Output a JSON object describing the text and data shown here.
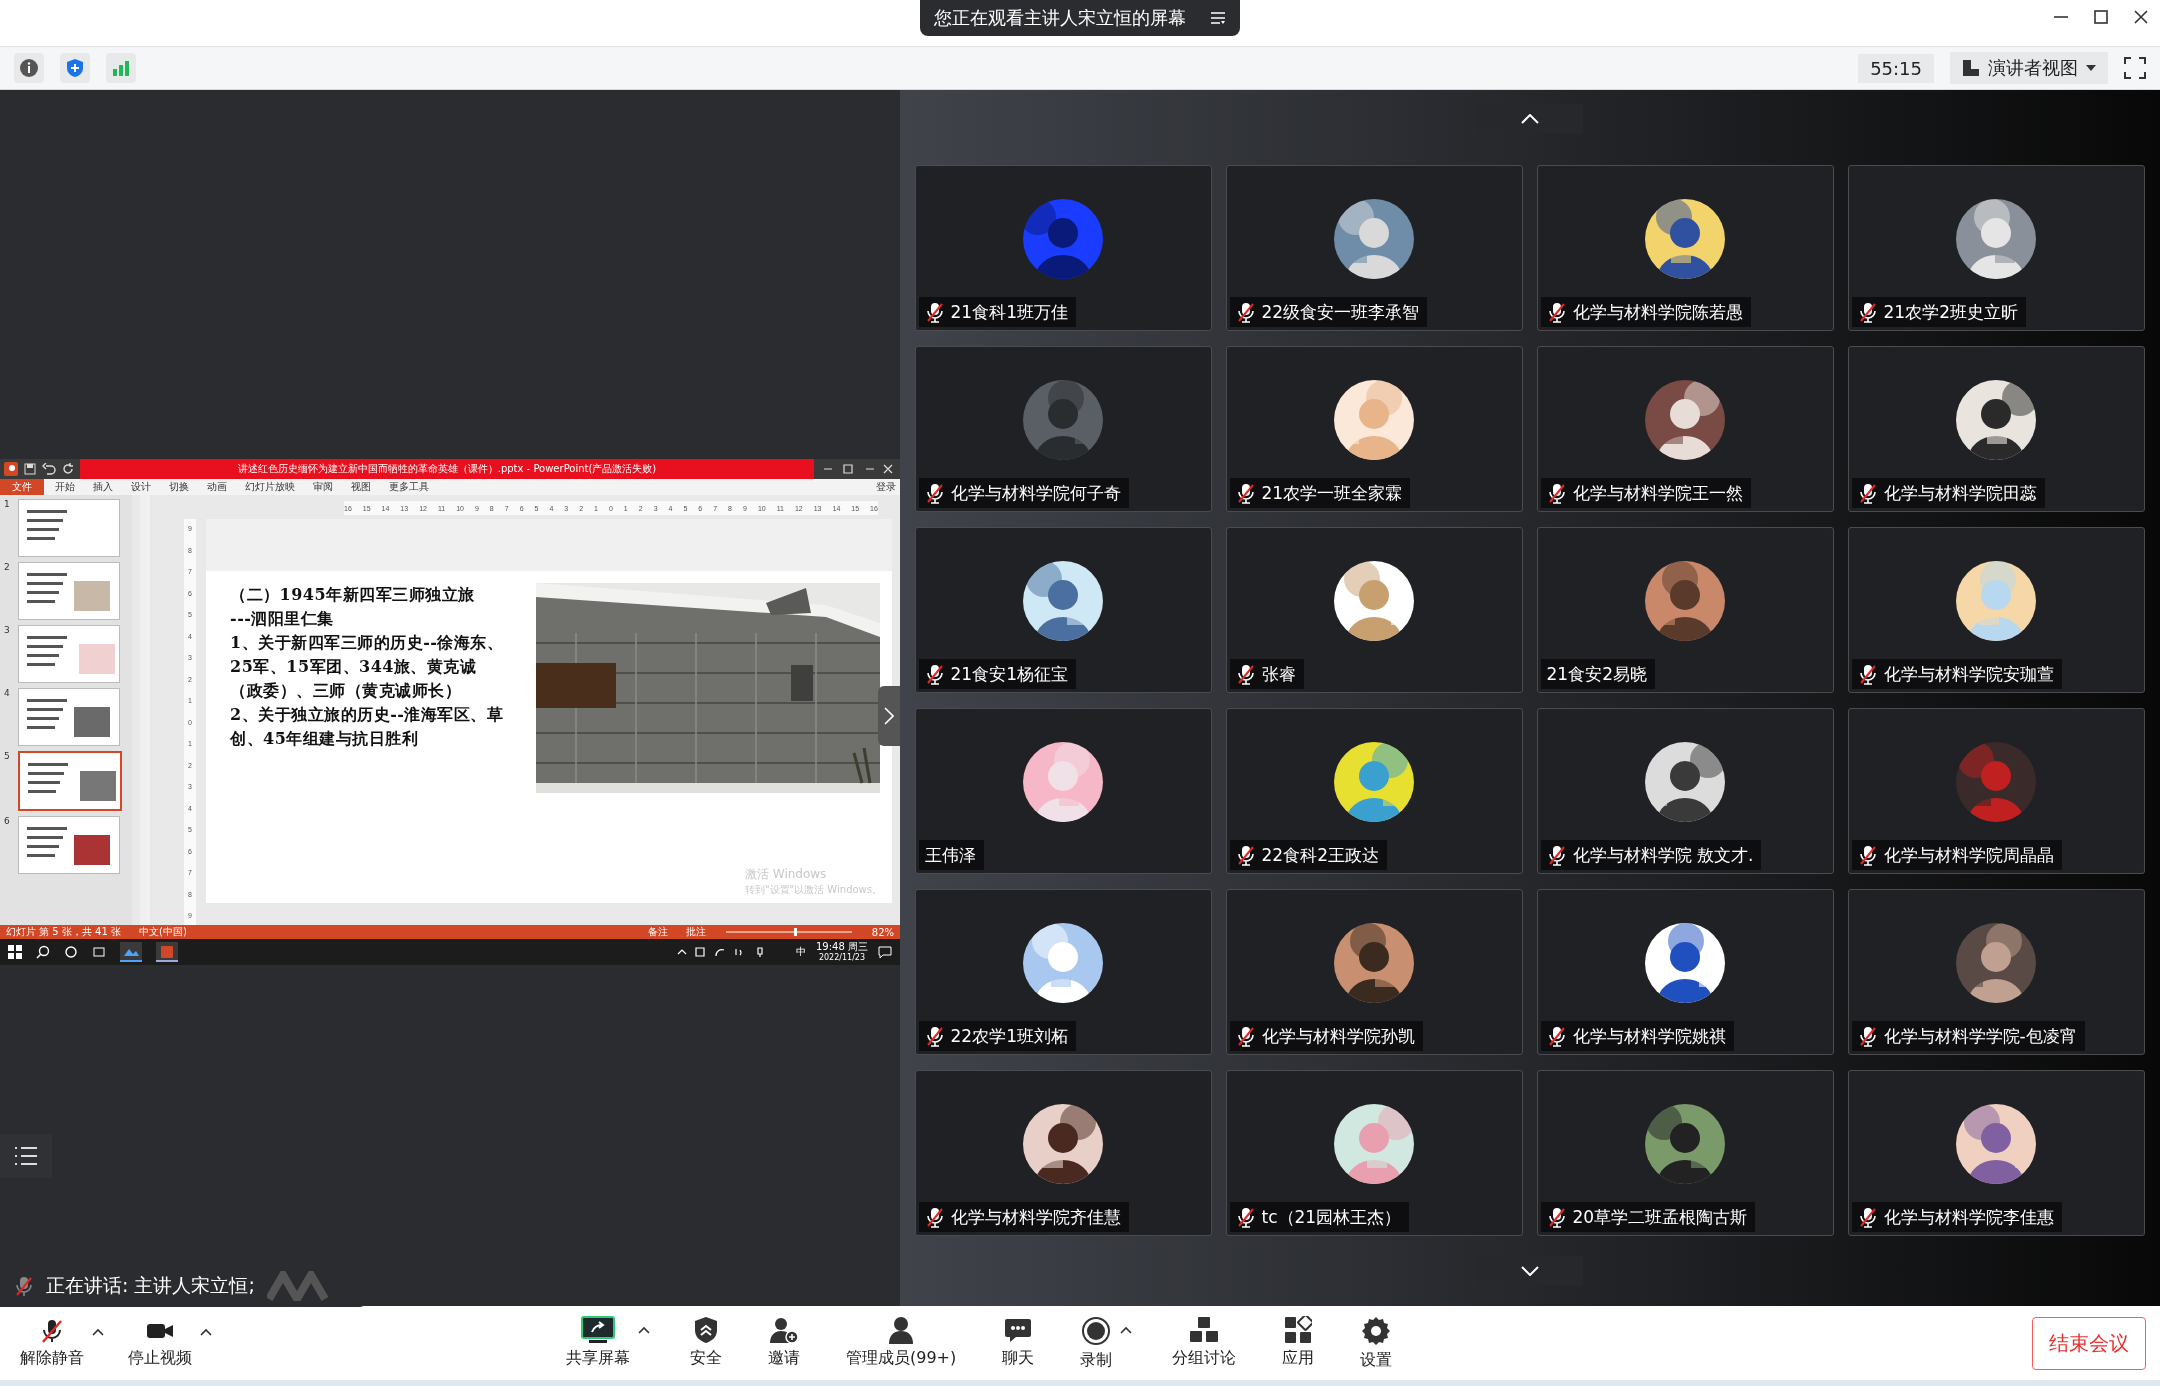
{
  "title_bar": {
    "notice": "您正在观看主讲人宋立恒的屏幕"
  },
  "toolbar": {
    "timer": "55:15",
    "view_menu": "演讲者视图"
  },
  "shared_screen": {
    "app_title": "讲述红色历史缅怀为建立新中国而牺牲的革命英雄（课件）.pptx - PowerPoint(产品激活失败)",
    "ribbon_tabs": [
      {
        "label": "文件",
        "selected": true
      },
      {
        "label": "开始",
        "selected": false
      },
      {
        "label": "插入",
        "selected": false
      },
      {
        "label": "设计",
        "selected": false
      },
      {
        "label": "切换",
        "selected": false
      },
      {
        "label": "动画",
        "selected": false
      },
      {
        "label": "幻灯片放映",
        "selected": false
      },
      {
        "label": "审阅",
        "selected": false
      },
      {
        "label": "视图",
        "selected": false
      },
      {
        "label": "更多工具",
        "selected": false
      }
    ],
    "sign_in": "登录",
    "thumbnails": [
      {
        "number": "1",
        "selected": false
      },
      {
        "number": "2",
        "selected": false
      },
      {
        "number": "3",
        "selected": false
      },
      {
        "number": "4",
        "selected": false
      },
      {
        "number": "5",
        "selected": true
      },
      {
        "number": "6",
        "selected": false
      }
    ],
    "ruler": [
      "16",
      "15",
      "14",
      "13",
      "12",
      "11",
      "10",
      "9",
      "8",
      "7",
      "6",
      "5",
      "4",
      "3",
      "2",
      "1",
      "0",
      "1",
      "2",
      "3",
      "4",
      "5",
      "6",
      "7",
      "8",
      "9",
      "10",
      "11",
      "12",
      "13",
      "14",
      "15",
      "16"
    ],
    "vertical_ruler": [
      "9",
      "8",
      "7",
      "6",
      "5",
      "4",
      "3",
      "2",
      "1",
      "0",
      "1",
      "2",
      "3",
      "4",
      "5",
      "6",
      "7",
      "8",
      "9"
    ],
    "slide": {
      "heading": "（二）1945年新四军三师独立旅",
      "subheading": "---泗阳里仁集",
      "paragraphs": [
        "1、关于新四军三师的历史--徐海东、25军、15军团、344旅、黄克诚（政委）、三师（黄克诚师长）",
        "2、关于独立旅的历史--淮海军区、草创、45年组建与抗日胜利"
      ]
    },
    "watermark": {
      "title": "激活 Windows",
      "hint": "转到\"设置\"以激活 Windows。"
    },
    "status_bar": {
      "slide_count": "幻灯片 第 5 张，共 41 张",
      "language": "中文(中国)",
      "notes": "备注",
      "comments": "批注",
      "zoom": "82%"
    },
    "taskbar": {
      "time": "19:48 周三",
      "date": "2022/11/23",
      "ime": "中"
    }
  },
  "participants": [
    {
      "name": "21食科1班万佳",
      "muted": true
    },
    {
      "name": "22级食安一班李承智",
      "muted": true
    },
    {
      "name": "化学与材料学院陈若愚",
      "muted": true
    },
    {
      "name": "21农学2班史立昕",
      "muted": true
    },
    {
      "name": "化学与材料学院何子奇",
      "muted": true
    },
    {
      "name": "21农学一班全家霖",
      "muted": true
    },
    {
      "name": "化学与材料学院王一然",
      "muted": true
    },
    {
      "name": "化学与材料学院田蕊",
      "muted": true
    },
    {
      "name": "21食安1杨征宝",
      "muted": true
    },
    {
      "name": "张睿",
      "muted": true
    },
    {
      "name": "21食安2易晓",
      "muted": false
    },
    {
      "name": "化学与材料学院安珈萱",
      "muted": true
    },
    {
      "name": "王伟泽",
      "muted": false
    },
    {
      "name": "22食科2王政达",
      "muted": true
    },
    {
      "name": "化学与材料学院 敖文才.",
      "muted": true
    },
    {
      "name": "化学与材料学院周晶晶",
      "muted": true
    },
    {
      "name": "22农学1班刘柘",
      "muted": true
    },
    {
      "name": "化学与材料学院孙凯",
      "muted": true
    },
    {
      "name": "化学与材料学院姚祺",
      "muted": true
    },
    {
      "name": "化学与材料学学院-包凌宵",
      "muted": true
    },
    {
      "name": "化学与材料学院齐佳慧",
      "muted": true
    },
    {
      "name": "tc（21园林王杰）",
      "muted": true
    },
    {
      "name": "20草学二班孟根陶古斯",
      "muted": true
    },
    {
      "name": "化学与材料学院李佳惠",
      "muted": true
    }
  ],
  "speaking": "正在讲话: 主讲人宋立恒;",
  "controls": [
    {
      "label": "解除静音",
      "kind": "mic",
      "caret": true
    },
    {
      "label": "停止视频",
      "kind": "video",
      "caret": true
    },
    {
      "label": "共享屏幕",
      "kind": "share",
      "caret": true
    },
    {
      "label": "安全",
      "kind": "shield",
      "caret": false
    },
    {
      "label": "邀请",
      "kind": "invite",
      "caret": false
    },
    {
      "label": "管理成员(99+)",
      "kind": "members",
      "caret": false
    },
    {
      "label": "聊天",
      "kind": "chat",
      "caret": false
    },
    {
      "label": "录制",
      "kind": "record",
      "caret": true
    },
    {
      "label": "分组讨论",
      "kind": "breakout",
      "caret": false
    },
    {
      "label": "应用",
      "kind": "apps",
      "caret": false
    },
    {
      "label": "设置",
      "kind": "settings",
      "caret": false
    }
  ],
  "end_button": "结束会议"
}
